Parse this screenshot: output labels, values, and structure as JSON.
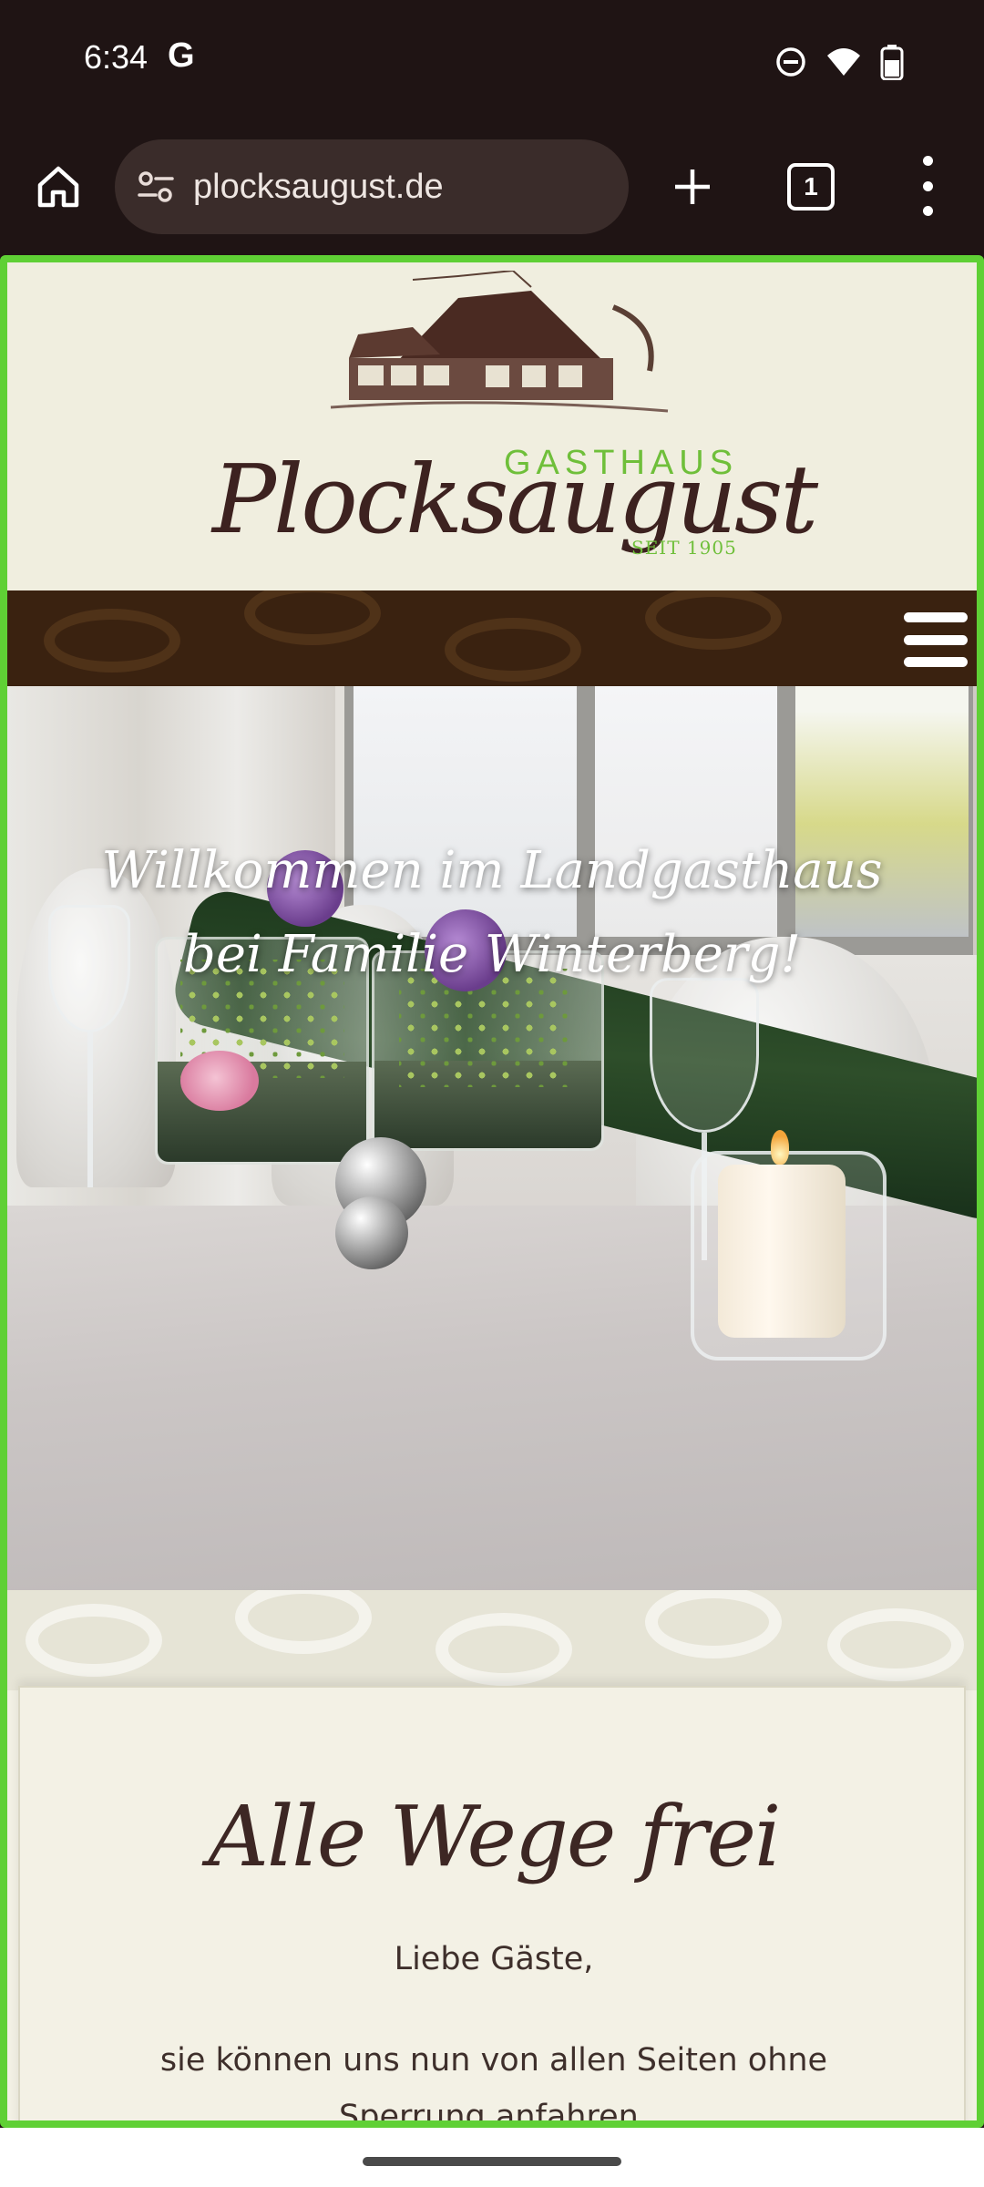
{
  "status_bar": {
    "time": "6:34",
    "google_indicator": "G",
    "icons": [
      "do-not-disturb-icon",
      "wifi-icon",
      "battery-icon"
    ]
  },
  "browser": {
    "url": "plocksaugust.de",
    "tab_count": "1",
    "icons": [
      "home-icon",
      "site-settings-icon",
      "new-tab-plus-icon",
      "tab-switcher-icon",
      "more-vert-icon"
    ]
  },
  "site": {
    "logo": {
      "gasthaus": "GASTHAUS",
      "name": "Plocksaugust",
      "since": "SEIT 1905"
    },
    "hero": {
      "line1": "Willkommen im Landgasthaus",
      "line2": "bei Familie Winterberg!"
    },
    "card": {
      "title": "Alle Wege frei",
      "greeting": "Liebe Gäste,",
      "body": "sie können uns nun von allen Seiten ohne Sperrung anfahren."
    }
  },
  "colors": {
    "accent_green": "#6fbf3a",
    "brand_brown": "#3d2220",
    "highlight_border": "#5fd035"
  }
}
